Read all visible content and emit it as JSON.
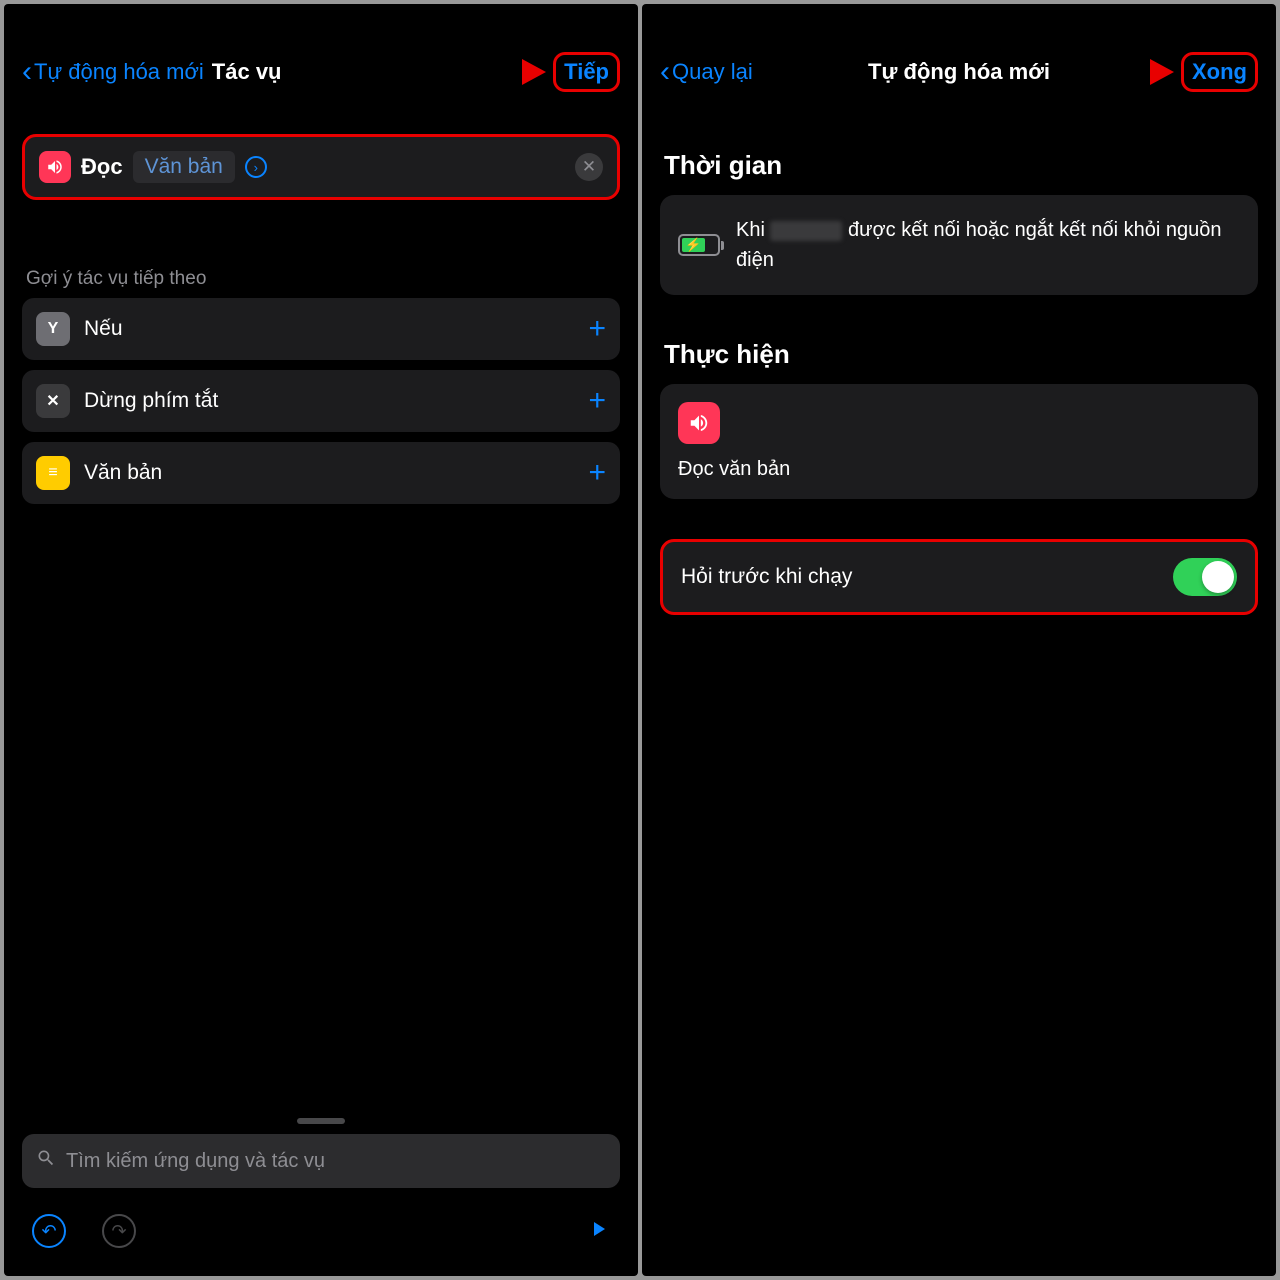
{
  "left": {
    "back_label": "Tự động hóa mới",
    "title": "Tác vụ",
    "next_label": "Tiếp",
    "action": {
      "name": "Đọc",
      "token": "Văn bản"
    },
    "suggest_header": "Gợi ý tác vụ tiếp theo",
    "suggestions": [
      {
        "icon": "Y",
        "icon_class": "gray",
        "label": "Nếu"
      },
      {
        "icon": "✕",
        "icon_class": "dark",
        "label": "Dừng phím tắt"
      },
      {
        "icon": "≡",
        "icon_class": "yellow",
        "label": "Văn bản"
      }
    ],
    "search_placeholder": "Tìm kiếm ứng dụng và tác vụ"
  },
  "right": {
    "back_label": "Quay lại",
    "title": "Tự động hóa mới",
    "done_label": "Xong",
    "time_header": "Thời gian",
    "time_text_1": "Khi",
    "time_text_2": "được kết nối hoặc ngắt kết nối khỏi nguồn điện",
    "exec_header": "Thực hiện",
    "exec_action": "Đọc văn bản",
    "ask_label": "Hỏi trước khi chạy"
  }
}
